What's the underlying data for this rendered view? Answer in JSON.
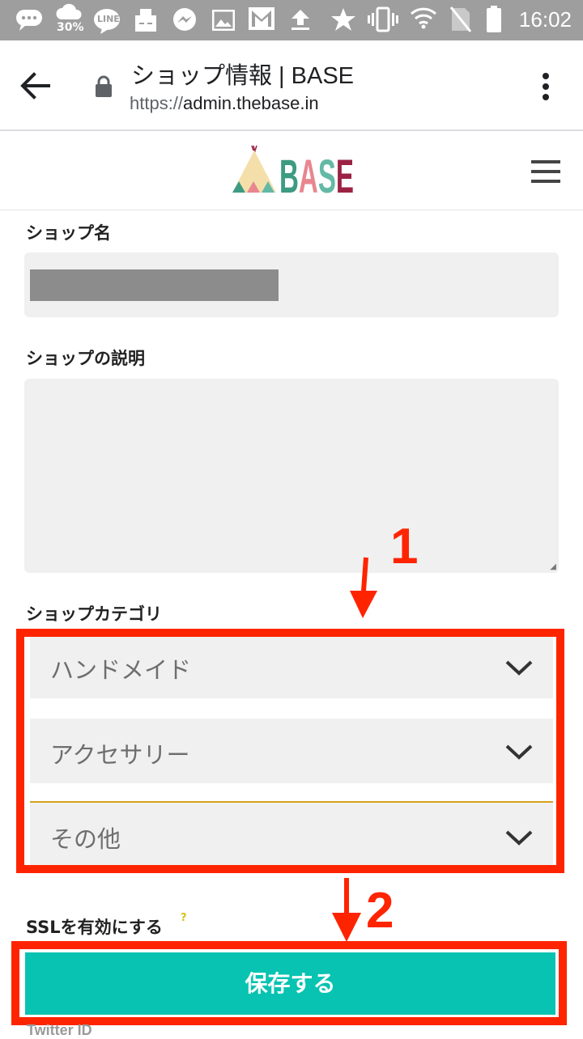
{
  "status_bar": {
    "battery_badge": "30%",
    "line_label": "LINE",
    "time": "16:02",
    "icons": [
      "chat-bubble-icon",
      "cloud-icon",
      "line-app-icon",
      "package-icon",
      "messenger-icon",
      "image-icon",
      "gmail-icon",
      "upload-icon",
      "star-icon",
      "vibrate-icon",
      "wifi-icon",
      "no-sim-icon",
      "battery-icon"
    ]
  },
  "browser": {
    "title": "ショップ情報 | BASE",
    "url_scheme": "https://",
    "url_host": "admin.thebase.in"
  },
  "site": {
    "logo_text": "BASE",
    "colors": {
      "teal": "#3d9b82",
      "pink": "#e8868f",
      "green": "#64b9a6",
      "maroon": "#9b2243",
      "beige": "#f4dfab"
    }
  },
  "form": {
    "shop_name_label": "ショップ名",
    "shop_desc_label": "ショップの説明",
    "category_label": "ショップカテゴリ",
    "categories": [
      "ハンドメイド",
      "アクセサリー",
      "その他"
    ],
    "ssl_label": "SSLを有効にする",
    "ssl_help": "?",
    "save_label": "保存する",
    "twitter_label": "Twitter ID"
  },
  "annotations": {
    "step1": "1",
    "step2": "2",
    "color": "#ff2400"
  },
  "colors": {
    "save_button": "#08c3b1",
    "field_bg": "#f0f0f0",
    "status_bar": "#9e9e9e"
  }
}
